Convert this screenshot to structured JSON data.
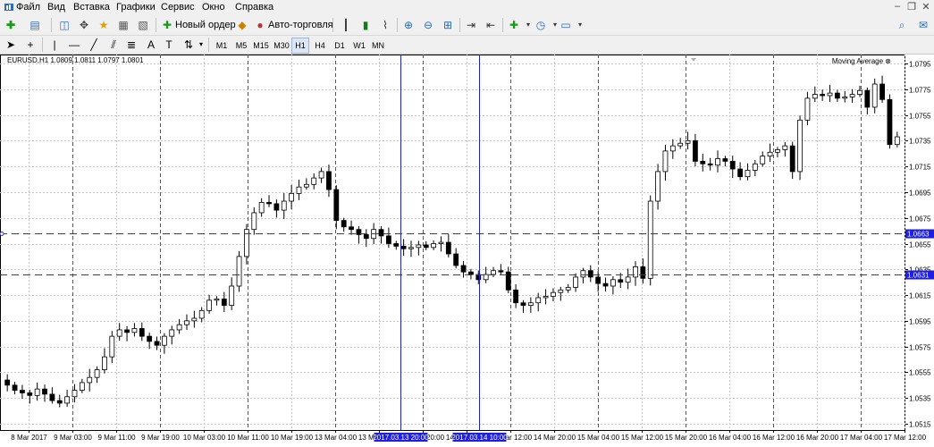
{
  "menu": {
    "items": [
      "Файл",
      "Вид",
      "Вставка",
      "Графики",
      "Сервис",
      "Окно",
      "Справка"
    ]
  },
  "toolbar": {
    "new_order_label": "Новый ордер",
    "autotrading_label": "Авто-торговля"
  },
  "timeframes": [
    "M1",
    "M5",
    "M15",
    "M30",
    "H1",
    "H4",
    "D1",
    "W1",
    "MN"
  ],
  "active_timeframe": "H1",
  "chart": {
    "symbol_label": "EURUSD,H1  1.0809 1.0811 1.0797 1.0801",
    "indicator_label": "Moving Average",
    "colors": {
      "grid": "#c8c8c8",
      "bull": "#ffffff",
      "bear": "#000000",
      "crosshair": "#2020c8",
      "hline": "#2a2ae0",
      "price_tag_bg": "#1e1ee6"
    }
  },
  "chart_data": {
    "type": "candlestick",
    "symbol": "EURUSD",
    "timeframe": "H1",
    "ohlc_header": {
      "open": 1.0809,
      "high": 1.0811,
      "low": 1.0797,
      "close": 1.0801
    },
    "y_ticks": [
      "1.0795",
      "1.0775",
      "1.0755",
      "1.0735",
      "1.0715",
      "1.0695",
      "1.0675",
      "1.0655",
      "1.0635",
      "1.0615",
      "1.0595",
      "1.0575",
      "1.0555",
      "1.0535",
      "1.0515"
    ],
    "ylim": [
      1.051,
      1.08
    ],
    "x_labels": [
      "8 Mar 2017",
      "9 Mar 03:00",
      "9 Mar 11:00",
      "9 Mar 19:00",
      "10 Mar 03:00",
      "10 Mar 11:00",
      "10 Mar 19:00",
      "13 Mar 04:00",
      "13 Mar 12:00",
      "13 Mar 20:00",
      "14 Mar 04:00",
      "14 Mar 12:00",
      "14 Mar 20:00",
      "15 Mar 04:00",
      "15 Mar 12:00",
      "15 Mar 20:00",
      "16 Mar 04:00",
      "16 Mar 12:00",
      "16 Mar 20:00",
      "17 Mar 04:00",
      "17 Mar 12:00"
    ],
    "horizontal_lines": [
      {
        "price": "1.0663"
      },
      {
        "price": "1.0631"
      }
    ],
    "vertical_lines": [
      {
        "label": "2017.03.13 20:00"
      },
      {
        "label": "2017.03.14 10:00"
      }
    ],
    "close_path": [
      1.0545,
      1.0541,
      1.0539,
      1.0537,
      1.0542,
      1.0538,
      1.0533,
      1.0531,
      1.0536,
      1.0541,
      1.0547,
      1.0551,
      1.0557,
      1.0567,
      1.0583,
      1.0588,
      1.0586,
      1.0589,
      1.0583,
      1.0579,
      1.0576,
      1.0583,
      1.0588,
      1.0592,
      1.0595,
      1.0597,
      1.0603,
      1.0611,
      1.0612,
      1.0607,
      1.0622,
      1.0645,
      1.0666,
      1.0679,
      1.0687,
      1.0686,
      1.0681,
      1.0688,
      1.0694,
      1.0699,
      1.0701,
      1.0706,
      1.0711,
      1.0697,
      1.0673,
      1.0668,
      1.0666,
      1.0662,
      1.0659,
      1.0666,
      1.0661,
      1.0655,
      1.0653,
      1.0651,
      1.0652,
      1.0654,
      1.0652,
      1.0655,
      1.0656,
      1.0647,
      1.0638,
      1.0633,
      1.0631,
      1.0627,
      1.0631,
      1.0634,
      1.0633,
      1.0619,
      1.0609,
      1.0607,
      1.0609,
      1.0613,
      1.0614,
      1.0617,
      1.0619,
      1.0621,
      1.0629,
      1.0634,
      1.0629,
      1.0624,
      1.0622,
      1.0627,
      1.0625,
      1.0629,
      1.0637,
      1.0628,
      1.0688,
      1.0711,
      1.0727,
      1.0731,
      1.0733,
      1.0735,
      1.0719,
      1.0717,
      1.0716,
      1.0721,
      1.0719,
      1.0713,
      1.0707,
      1.0712,
      1.0717,
      1.0723,
      1.0726,
      1.0728,
      1.0731,
      1.0711,
      1.0751,
      1.0768,
      1.0771,
      1.077,
      1.0772,
      1.0768,
      1.0769,
      1.0771,
      1.0774,
      1.0761,
      1.0779,
      1.0767,
      1.0732,
      1.0738
    ]
  }
}
